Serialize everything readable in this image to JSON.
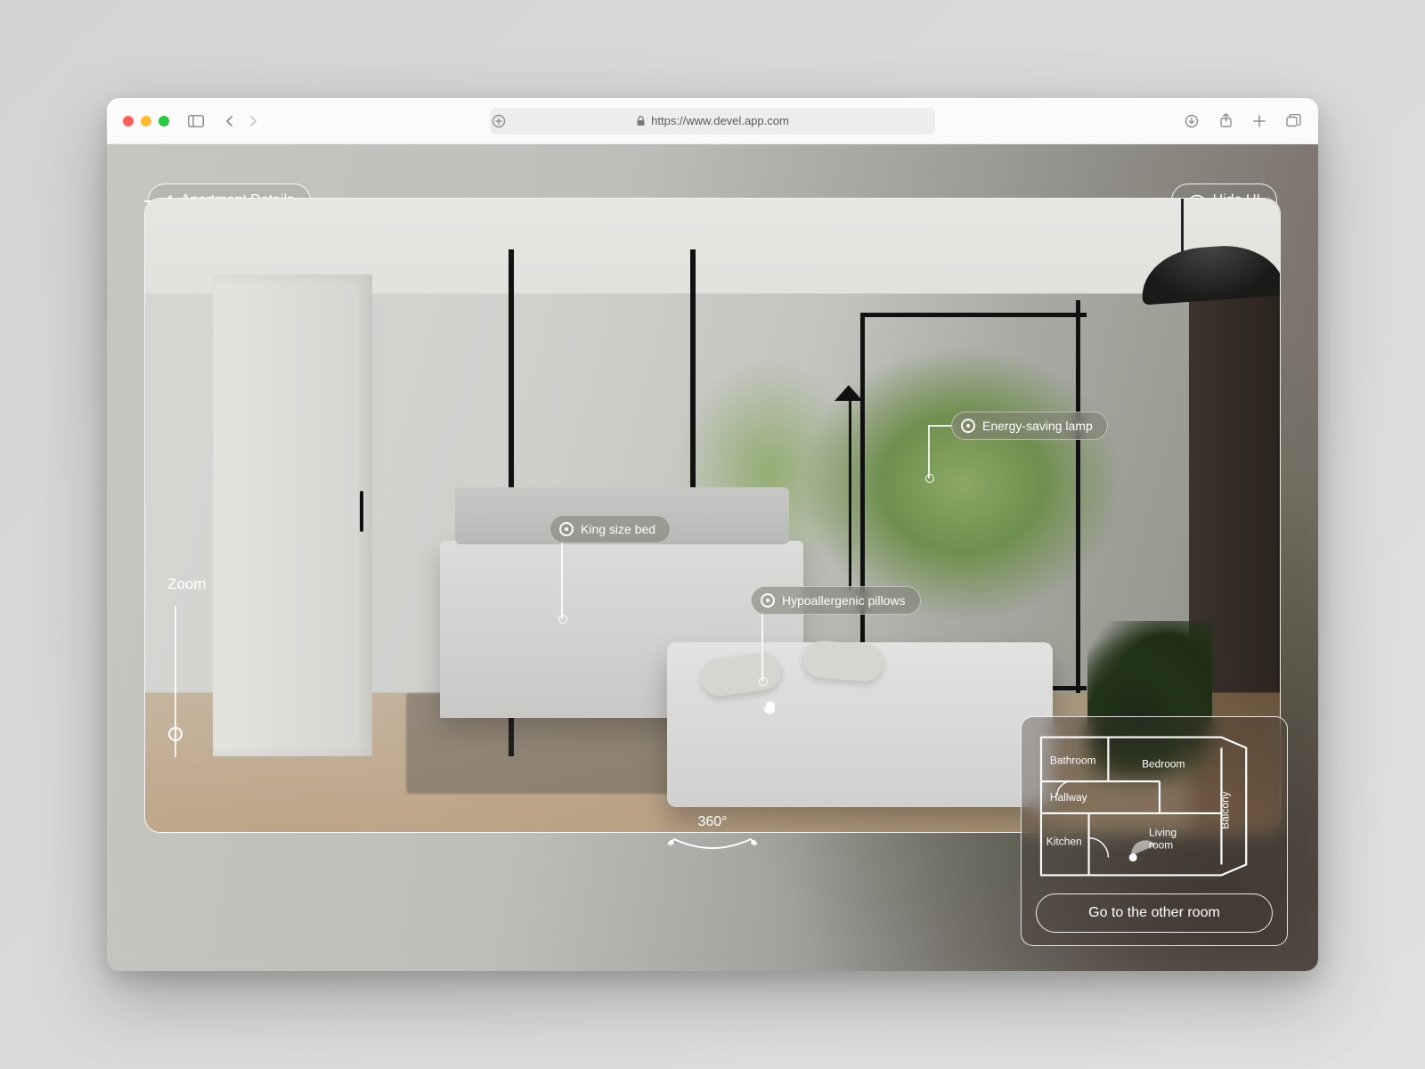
{
  "browser": {
    "url": "https://www.devel.app.com"
  },
  "header": {
    "back_label": "Apartment Details",
    "hide_label": "Hide UI"
  },
  "zoom": {
    "label": "Zoom"
  },
  "rotate": {
    "label": "360°"
  },
  "hotspots": {
    "bed": "King size bed",
    "pillows": "Hypoallergenic pillows",
    "lamp": "Energy-saving lamp"
  },
  "minimap": {
    "rooms": {
      "bathroom": "Bathroom",
      "bedroom": "Bedroom",
      "hallway": "Hallway",
      "kitchen": "Kitchen",
      "living": "Living room",
      "balcony": "Balcony"
    },
    "cta": "Go to the other room"
  }
}
